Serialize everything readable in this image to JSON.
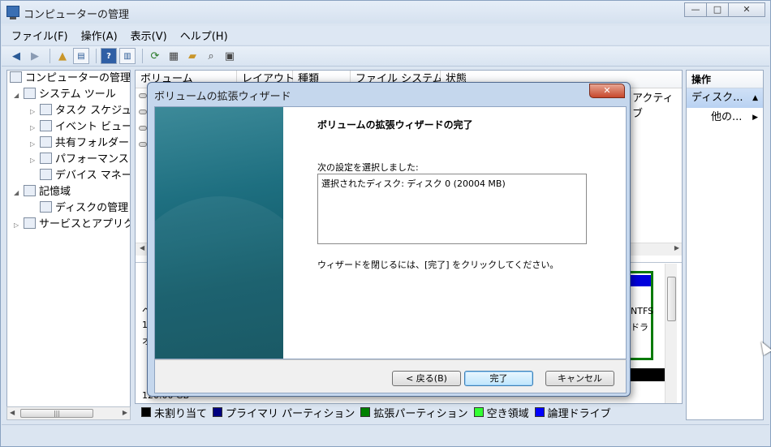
{
  "window": {
    "title": "コンピューターの管理",
    "min": "▭",
    "max": "□",
    "close": "✕"
  },
  "menu": [
    "ファイル(F)",
    "操作(A)",
    "表示(V)",
    "ヘルプ(H)"
  ],
  "tree": {
    "root": "コンピューターの管理",
    "system_tools": "システム ツール",
    "task_scheduler": "タスク スケジュ",
    "event_viewer": "イベント ビュー",
    "shared_folders": "共有フォルダー",
    "performance": "パフォーマンス",
    "device_manager": "デバイス マネー",
    "storage": "記憶域",
    "disk_management": "ディスクの管理",
    "services": "サービスとアプリク"
  },
  "columns": [
    "ボリューム",
    "レイアウト",
    "種類",
    "ファイル システム",
    "状態"
  ],
  "middle_fragments": {
    "active": "アクティブ",
    "ntfs": "NTFS",
    "dra": "ドラ",
    "lower_left_1": "ベ",
    "lower_left_2": "1",
    "lower_left_3": "オ",
    "lower_bottom": "120.00 GB"
  },
  "legend": [
    {
      "label": "未割り当て",
      "color": "#000000"
    },
    {
      "label": "プライマリ パーティション",
      "color": "#000080"
    },
    {
      "label": "拡張パーティション",
      "color": "#008000"
    },
    {
      "label": "空き領域",
      "color": "#33ff33"
    },
    {
      "label": "論理ドライブ",
      "color": "#0000ff"
    }
  ],
  "actions": {
    "header": "操作",
    "selected": "ディスク...",
    "more": "他の..."
  },
  "dialog": {
    "title": "ボリュームの拡張ウィザード",
    "heading": "ボリュームの拡張ウィザードの完了",
    "selected_label": "次の設定を選択しました:",
    "listbox_text": "選択されたディスク: ディスク 0 (20004 MB)",
    "footer_text": "ウィザードを閉じるには、[完了] をクリックしてください。",
    "back_button": "< 戻る(B)",
    "finish_button": "完了",
    "cancel_button": "キャンセル"
  }
}
